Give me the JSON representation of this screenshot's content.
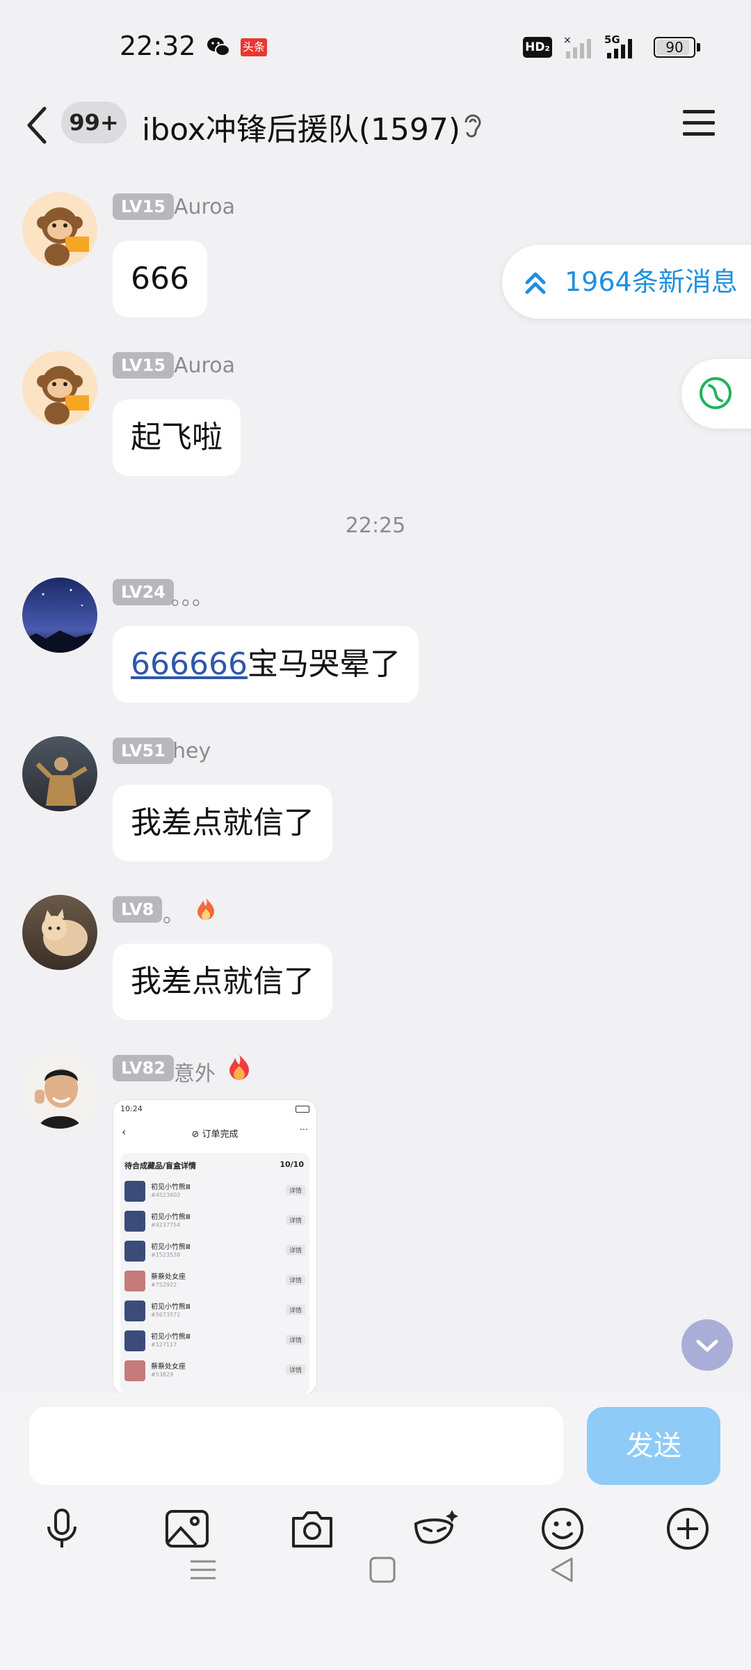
{
  "status_bar": {
    "time": "22:32",
    "toutiao": "头条",
    "hd": "HD₂",
    "network": "5G",
    "battery": "90",
    "battery_level": 0.9
  },
  "header": {
    "unread_badge": "99+",
    "title": "ibox冲锋后援队(1597)"
  },
  "floating": {
    "new_messages": "1964条新消息"
  },
  "messages": [
    {
      "level": "LV15",
      "nickname": "Auroa",
      "text": "666"
    },
    {
      "level": "LV15",
      "nickname": "Auroa",
      "text": "起飞啦"
    },
    {
      "timestamp": "22:25"
    },
    {
      "level": "LV24",
      "nickname": "。。。",
      "link_text": "666666",
      "text": "宝马哭晕了"
    },
    {
      "level": "LV51",
      "nickname": "hey",
      "text": "我差点就信了"
    },
    {
      "level": "LV8",
      "nickname": "。",
      "text": "我差点就信了"
    },
    {
      "level": "LV82",
      "nickname": "意外",
      "image": {
        "time": "10:24",
        "title": "订单完成",
        "section": "待合成藏品/盲盒详情",
        "count": "10/10",
        "detail_label": "详情",
        "items": [
          {
            "name": "初见小竹熊Ⅲ",
            "id": "#4523602"
          },
          {
            "name": "初见小竹熊Ⅲ",
            "id": "#9237754"
          },
          {
            "name": "初见小竹熊Ⅲ",
            "id": "#1523538"
          },
          {
            "name": "蔡蔡处女座",
            "id": "#752922"
          },
          {
            "name": "初见小竹熊Ⅲ",
            "id": "#5673572"
          },
          {
            "name": "初见小竹熊Ⅲ",
            "id": "#127117"
          },
          {
            "name": "蔡蔡处女座",
            "id": "#53829"
          }
        ]
      }
    }
  ],
  "input": {
    "placeholder": "",
    "send_label": "发送"
  }
}
